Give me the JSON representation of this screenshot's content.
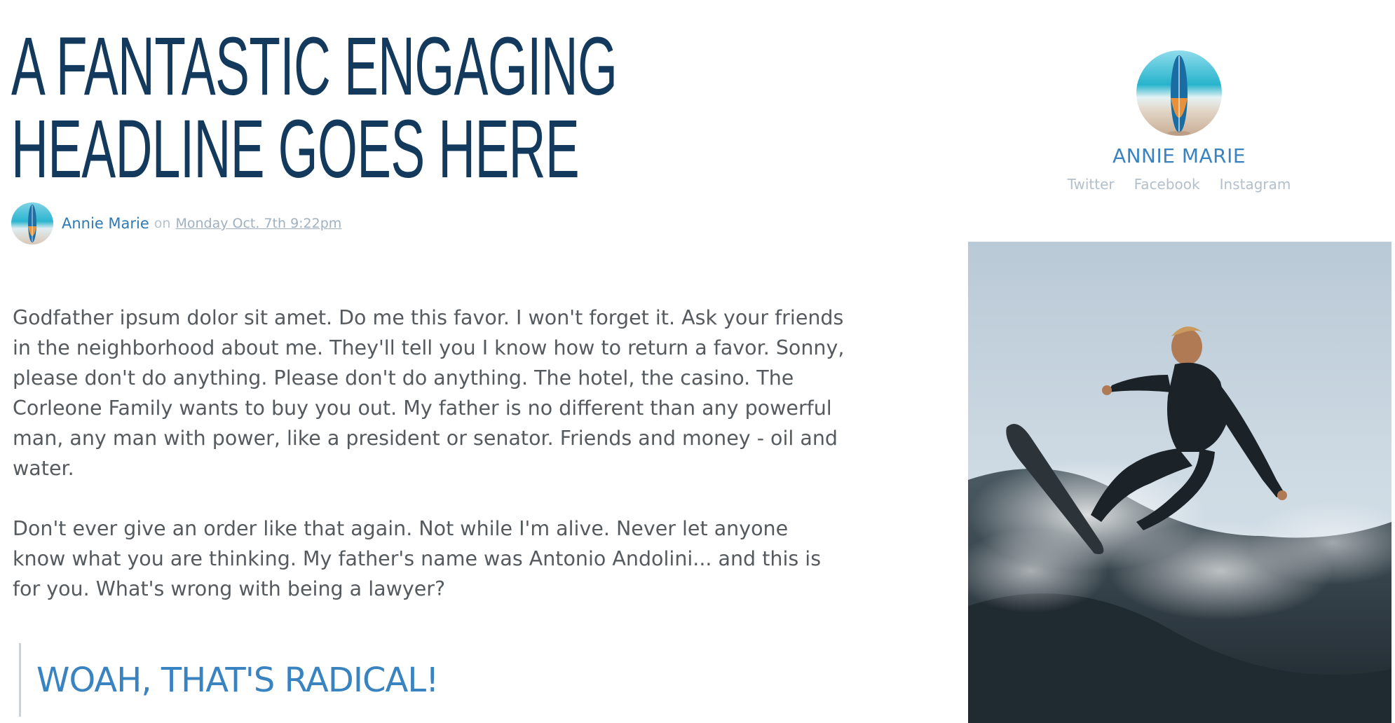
{
  "article": {
    "headline_line1": "A FANTASTIC ENGAGING",
    "headline_line2": "HEADLINE GOES HERE",
    "author": "Annie Marie",
    "on": "on",
    "date": "Monday Oct. 7th 9:22pm",
    "paragraphs": [
      "Godfather ipsum dolor sit amet. Do me this favor. I won't forget it. Ask your friends in the neighborhood about me. They'll tell you I know how to return a favor. Sonny, please don't do anything. Please don't do anything. The hotel, the casino. The Corleone Family wants to buy you out. My father is no different than any powerful man, any man with power, like a president or senator. Friends and money - oil and water.",
      "Don't ever give an order like that again. Not while I'm alive. Never let anyone know what you are thinking. My father's name was Antonio Andolini... and this is for you. What's wrong with being a lawyer?"
    ],
    "pullquote": "WOAH, THAT'S RADICAL!"
  },
  "sidebar": {
    "name": "ANNIE MARIE",
    "socials": [
      "Twitter",
      "Facebook",
      "Instagram"
    ]
  },
  "colors": {
    "headline": "#133a5c",
    "accent": "#3a83c1",
    "body_text": "#555a5f",
    "muted": "#b3bfcb"
  },
  "icons": {
    "avatar": "surfboard-on-beach-avatar",
    "photo": "surfer-riding-wave-photo"
  }
}
